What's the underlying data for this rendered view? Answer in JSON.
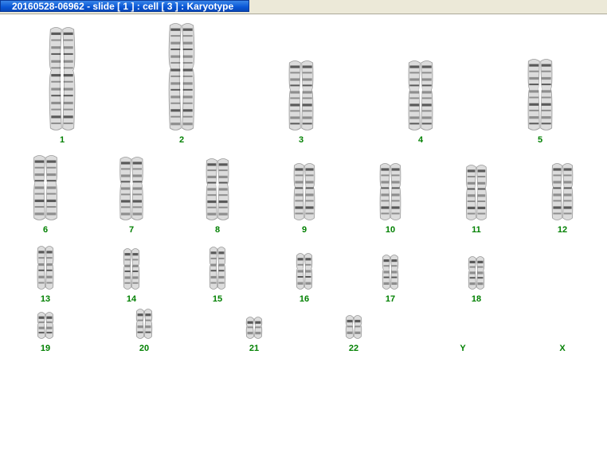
{
  "window": {
    "title": "20160528-06962 - slide [ 1 ] : cell [ 3 ] : Karyotype"
  },
  "colors": {
    "label": "#008000",
    "chromosome": "#2f2f2f",
    "titlebar": "#0a57d6"
  },
  "karyotype": {
    "pairs": [
      {
        "label": "1"
      },
      {
        "label": "2"
      },
      {
        "label": "3"
      },
      {
        "label": "4"
      },
      {
        "label": "5"
      },
      {
        "label": "6"
      },
      {
        "label": "7"
      },
      {
        "label": "8"
      },
      {
        "label": "9"
      },
      {
        "label": "10"
      },
      {
        "label": "11"
      },
      {
        "label": "12"
      },
      {
        "label": "13"
      },
      {
        "label": "14"
      },
      {
        "label": "15"
      },
      {
        "label": "16"
      },
      {
        "label": "17"
      },
      {
        "label": "18"
      },
      {
        "label": "19"
      },
      {
        "label": "20"
      },
      {
        "label": "21"
      },
      {
        "label": "22"
      },
      {
        "label": "Y"
      },
      {
        "label": "X"
      }
    ]
  }
}
